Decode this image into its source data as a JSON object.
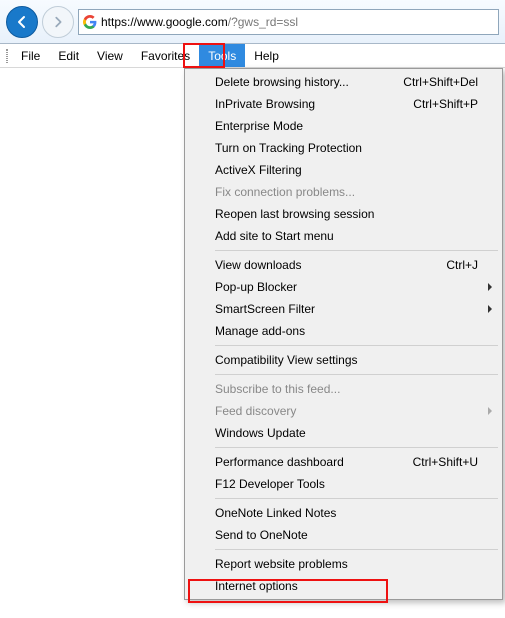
{
  "url": {
    "host": "https://www.google.com",
    "path": "/?gws_rd=ssl"
  },
  "menubar": [
    "File",
    "Edit",
    "View",
    "Favorites",
    "Tools",
    "Help"
  ],
  "menubar_active_index": 4,
  "dropdown": [
    {
      "type": "item",
      "label": "Delete browsing history...",
      "shortcut": "Ctrl+Shift+Del"
    },
    {
      "type": "item",
      "label": "InPrivate Browsing",
      "shortcut": "Ctrl+Shift+P"
    },
    {
      "type": "item",
      "label": "Enterprise Mode"
    },
    {
      "type": "item",
      "label": "Turn on Tracking Protection"
    },
    {
      "type": "item",
      "label": "ActiveX Filtering"
    },
    {
      "type": "item",
      "label": "Fix connection problems...",
      "disabled": true
    },
    {
      "type": "item",
      "label": "Reopen last browsing session"
    },
    {
      "type": "item",
      "label": "Add site to Start menu"
    },
    {
      "type": "sep"
    },
    {
      "type": "item",
      "label": "View downloads",
      "shortcut": "Ctrl+J"
    },
    {
      "type": "item",
      "label": "Pop-up Blocker",
      "submenu": true
    },
    {
      "type": "item",
      "label": "SmartScreen Filter",
      "submenu": true
    },
    {
      "type": "item",
      "label": "Manage add-ons"
    },
    {
      "type": "sep"
    },
    {
      "type": "item",
      "label": "Compatibility View settings"
    },
    {
      "type": "sep"
    },
    {
      "type": "item",
      "label": "Subscribe to this feed...",
      "disabled": true
    },
    {
      "type": "item",
      "label": "Feed discovery",
      "disabled": true,
      "submenu": true
    },
    {
      "type": "item",
      "label": "Windows Update"
    },
    {
      "type": "sep"
    },
    {
      "type": "item",
      "label": "Performance dashboard",
      "shortcut": "Ctrl+Shift+U"
    },
    {
      "type": "item",
      "label": "F12 Developer Tools"
    },
    {
      "type": "sep"
    },
    {
      "type": "item",
      "label": "OneNote Linked Notes"
    },
    {
      "type": "item",
      "label": "Send to OneNote"
    },
    {
      "type": "sep"
    },
    {
      "type": "item",
      "label": "Report website problems"
    },
    {
      "type": "item",
      "label": "Internet options"
    }
  ]
}
